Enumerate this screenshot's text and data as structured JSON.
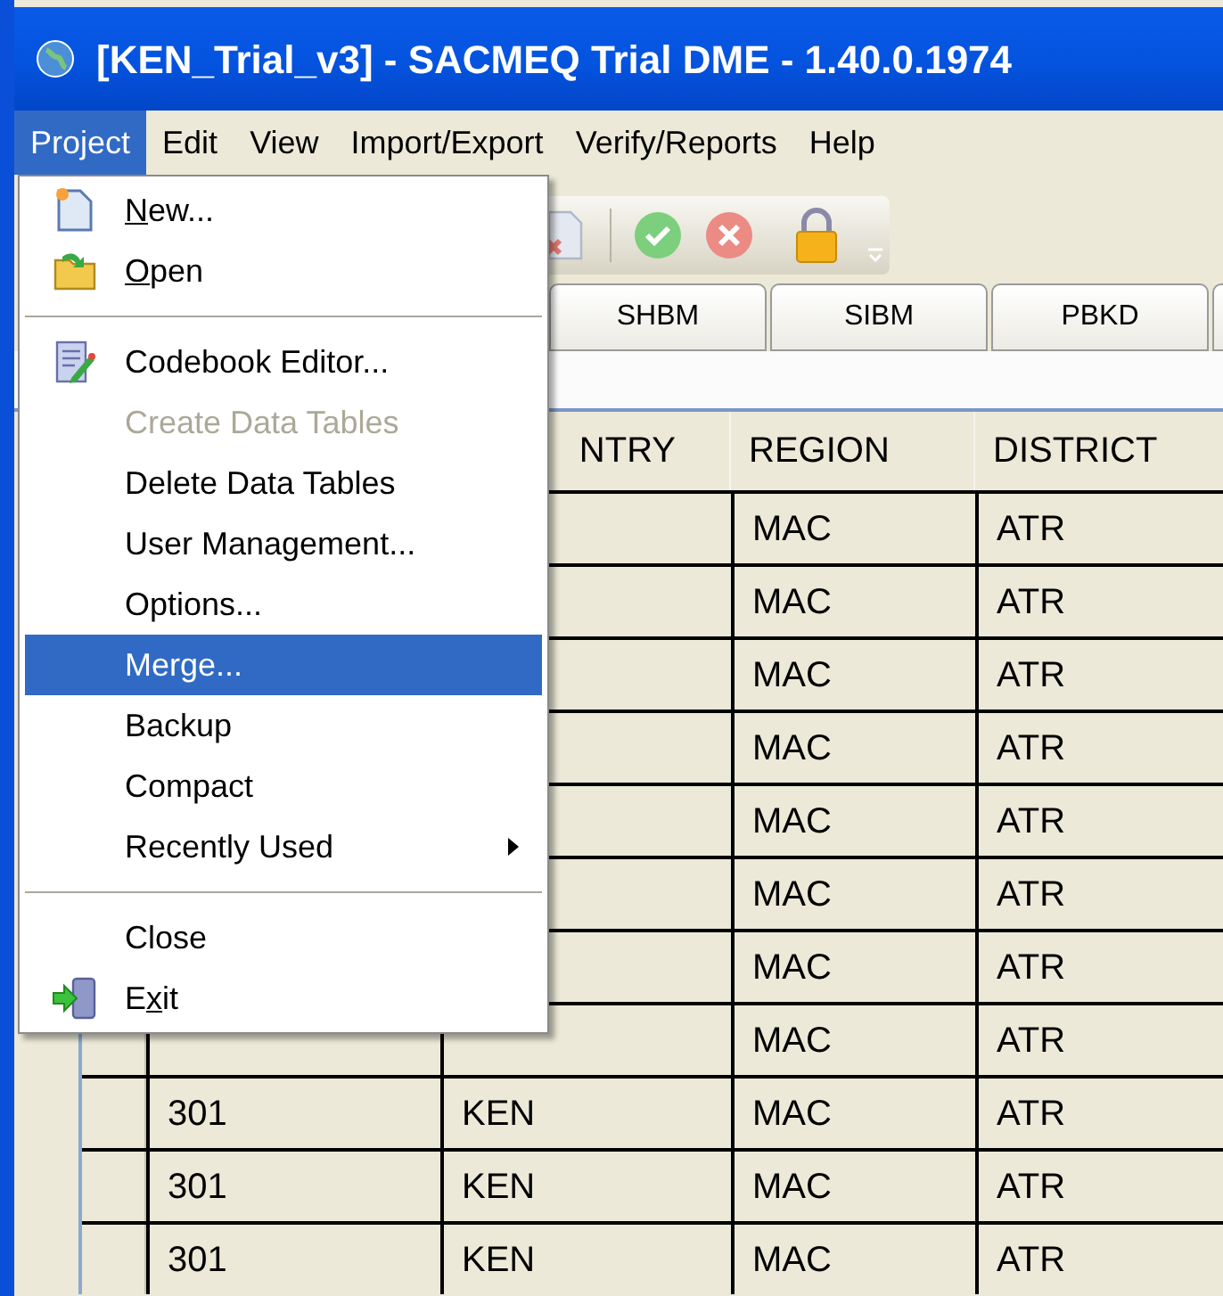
{
  "window": {
    "title": "[KEN_Trial_v3] - SACMEQ Trial DME - 1.40.0.1974"
  },
  "menu_bar": [
    {
      "label": "Project",
      "selected": true
    },
    {
      "label": "Edit",
      "selected": false
    },
    {
      "label": "View",
      "selected": false
    },
    {
      "label": "Import/Export",
      "selected": false
    },
    {
      "label": "Verify/Reports",
      "selected": false
    },
    {
      "label": "Help",
      "selected": false
    }
  ],
  "project_menu": [
    {
      "kind": "document",
      "key": "N",
      "after": "ew...",
      "disabled": false,
      "selected": false
    },
    {
      "kind": "folder",
      "key": "O",
      "after": "pen",
      "disabled": false,
      "selected": false
    },
    {
      "kind": "separator"
    },
    {
      "kind": "editor",
      "before": "Codebook Editor...",
      "disabled": false,
      "selected": false
    },
    {
      "kind": "plain",
      "before": "Create Data Tables",
      "disabled": true,
      "selected": false
    },
    {
      "kind": "plain",
      "before": "Delete Data Tables",
      "disabled": false,
      "selected": false
    },
    {
      "kind": "plain",
      "before": "User Management...",
      "disabled": false,
      "selected": false
    },
    {
      "kind": "plain",
      "before": "Options...",
      "disabled": false,
      "selected": false
    },
    {
      "kind": "plain",
      "before": "Merge...",
      "disabled": false,
      "selected": true
    },
    {
      "kind": "plain",
      "before": "Backup",
      "disabled": false,
      "selected": false
    },
    {
      "kind": "plain",
      "before": "Compact",
      "disabled": false,
      "selected": false
    },
    {
      "kind": "submenu",
      "before": "Recently Used",
      "disabled": false,
      "selected": false
    },
    {
      "kind": "separator"
    },
    {
      "kind": "plain",
      "before": "Close",
      "disabled": false,
      "selected": false
    },
    {
      "kind": "exit",
      "before": "E",
      "key": "x",
      "after": "it",
      "disabled": false,
      "selected": false
    }
  ],
  "tabs": [
    {
      "label": "SHBM",
      "selected": false
    },
    {
      "label": "SIBM",
      "selected": false
    },
    {
      "label": "PBKD",
      "selected": false
    },
    {
      "selected": false
    }
  ],
  "table": {
    "header": {
      "column_2": "NTRY",
      "column_3": "REGION",
      "column_4": "DISTRICT"
    },
    "rows": [
      {
        "column_3": "MAC",
        "column_4": "ATR"
      },
      {
        "column_3": "MAC",
        "column_4": "ATR"
      },
      {
        "column_3": "MAC",
        "column_4": "ATR"
      },
      {
        "column_3": "MAC",
        "column_4": "ATR"
      },
      {
        "column_3": "MAC",
        "column_4": "ATR"
      },
      {
        "column_3": "MAC",
        "column_4": "ATR"
      },
      {
        "column_3": "MAC",
        "column_4": "ATR"
      },
      {
        "column_3": "MAC",
        "column_4": "ATR"
      },
      {
        "column_1": "301",
        "column_2": "KEN",
        "column_3": "MAC",
        "column_4": "ATR"
      },
      {
        "column_1": "301",
        "column_2": "KEN",
        "column_3": "MAC",
        "column_4": "ATR"
      },
      {
        "column_1": "301",
        "column_2": "KEN",
        "column_3": "MAC",
        "column_4": "ATR"
      }
    ]
  }
}
